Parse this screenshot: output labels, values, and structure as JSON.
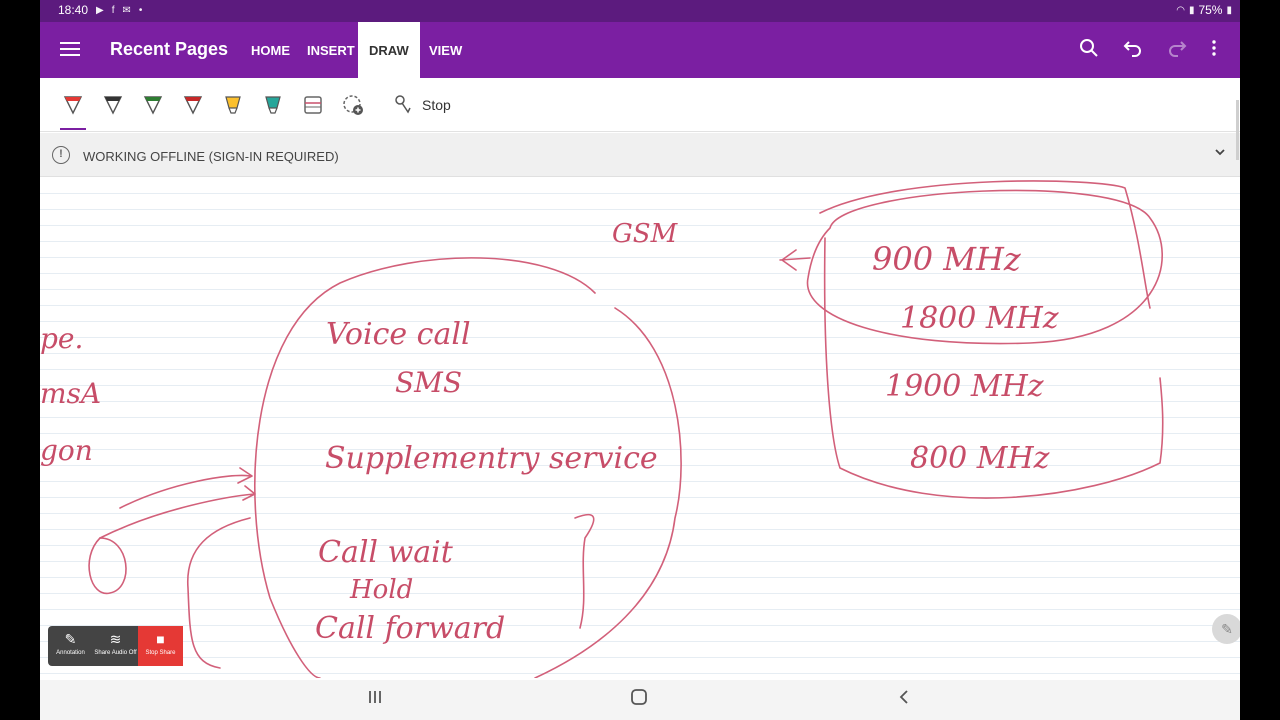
{
  "status_bar": {
    "time": "18:40",
    "battery": "75%"
  },
  "app": {
    "title": "Recent Pages"
  },
  "tabs": [
    {
      "label": "HOME"
    },
    {
      "label": "INSERT"
    },
    {
      "label": "DRAW"
    },
    {
      "label": "VIEW"
    }
  ],
  "toolbar": {
    "stop_label": "Stop"
  },
  "pens": [
    {
      "name": "red-pen",
      "color": "#e53935"
    },
    {
      "name": "black-pen",
      "color": "#333333"
    },
    {
      "name": "green-pen",
      "color": "#2e7d32"
    },
    {
      "name": "red-pen-2",
      "color": "#c62828"
    },
    {
      "name": "yellow-highlighter",
      "color": "#fbc02d"
    },
    {
      "name": "cyan-highlighter",
      "color": "#26a69a"
    }
  ],
  "banner": {
    "text": "WORKING OFFLINE (SIGN-IN REQUIRED)"
  },
  "notes": {
    "gsm": "GSM",
    "freq_1": "900 MHz",
    "freq_2": "1800 MHz",
    "freq_3": "1900 MHz",
    "freq_4": "800 MHz",
    "service_1": "Voice call",
    "service_2": "SMS",
    "service_3": "Supplementry service",
    "service_4": "Call wait",
    "service_5": "Hold",
    "service_6": "Call forward",
    "left_1": "pe.",
    "left_2": "msA",
    "left_3": "gon"
  },
  "share": {
    "annotation_label": "Annotation",
    "share_audio_label": "Share Audio Off",
    "stop_share_label": "Stop Share"
  },
  "colors": {
    "accent": "#7b1fa2",
    "ink": "#d2607a"
  }
}
